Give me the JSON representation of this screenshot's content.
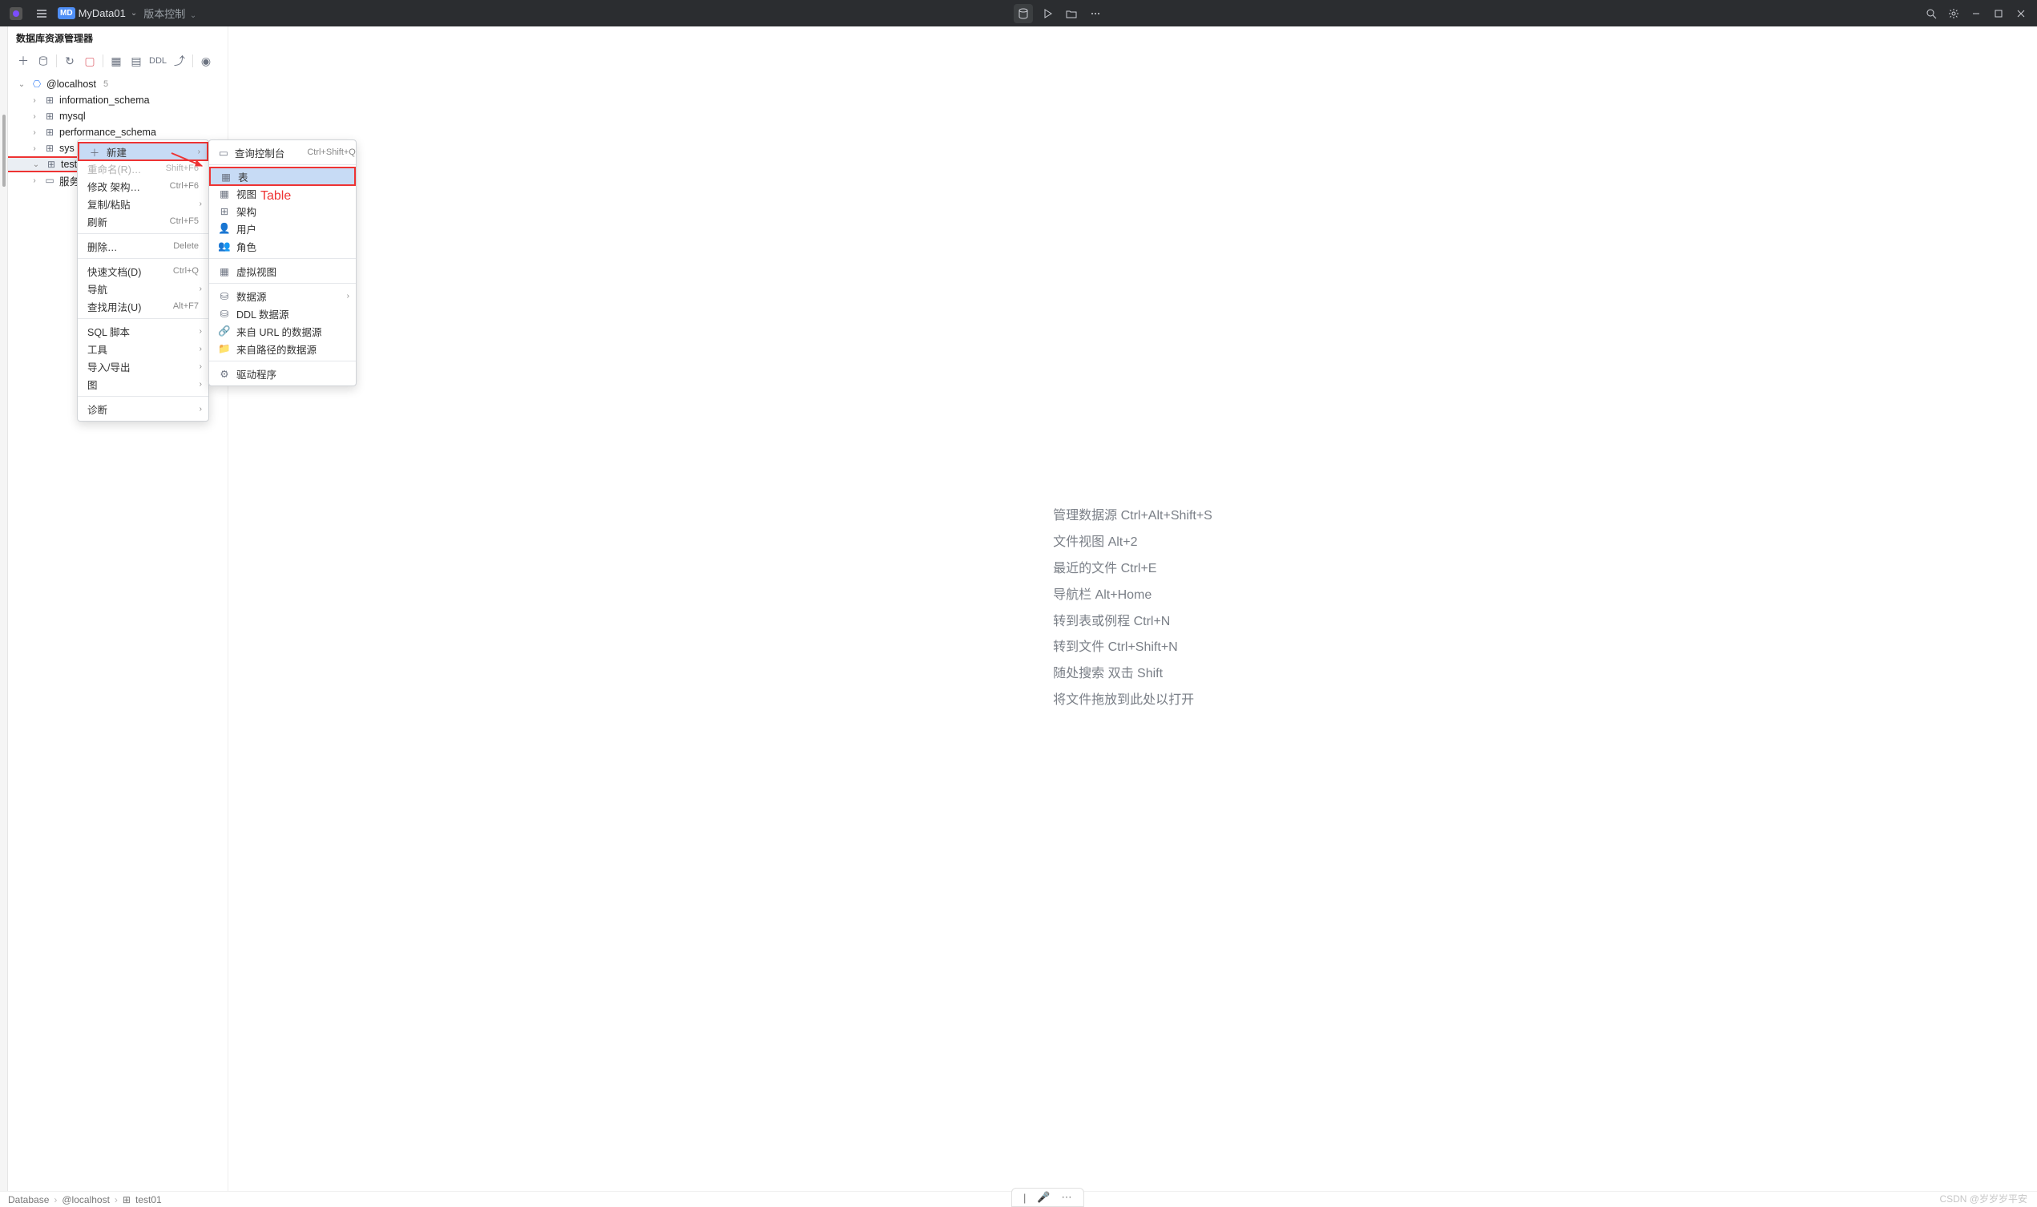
{
  "titlebar": {
    "project_badge": "MD",
    "project_name": "MyData01",
    "vcs_label": "版本控制"
  },
  "sidebar": {
    "title": "数据库资源管理器",
    "toolbar_ddl": "DDL",
    "root": {
      "label": "@localhost",
      "count": "5"
    },
    "children": [
      {
        "label": "information_schema"
      },
      {
        "label": "mysql"
      },
      {
        "label": "performance_schema"
      },
      {
        "label": "sys"
      },
      {
        "label": "test01"
      },
      {
        "label": "服务器"
      }
    ]
  },
  "context_menu": {
    "new": "新建",
    "rename": "重命名(R)…",
    "rename_kbd": "Shift+F6",
    "modify_schema": "修改 架构…",
    "modify_kbd": "Ctrl+F6",
    "copy_paste": "复制/粘贴",
    "refresh": "刷新",
    "refresh_kbd": "Ctrl+F5",
    "delete": "删除…",
    "delete_kbd": "Delete",
    "quick_doc": "快速文档(D)",
    "quick_doc_kbd": "Ctrl+Q",
    "navigate": "导航",
    "find_usages": "查找用法(U)",
    "find_usages_kbd": "Alt+F7",
    "sql_script": "SQL 脚本",
    "tools": "工具",
    "import_export": "导入/导出",
    "diagram": "图",
    "diagnose": "诊断"
  },
  "submenu": {
    "query_console": "查询控制台",
    "query_console_kbd": "Ctrl+Shift+Q",
    "table": "表",
    "view": "视图",
    "schema": "架构",
    "user": "用户",
    "role": "角色",
    "virtual_view": "虚拟视图",
    "data_source": "数据源",
    "ddl_data_source": "DDL 数据源",
    "url_data_source": "来自 URL 的数据源",
    "path_data_source": "来自路径的数据源",
    "driver": "驱动程序"
  },
  "annotation": "Table",
  "shortcuts": [
    "管理数据源 Ctrl+Alt+Shift+S",
    "文件视图 Alt+2",
    "最近的文件 Ctrl+E",
    "导航栏 Alt+Home",
    "转到表或例程 Ctrl+N",
    "转到文件 Ctrl+Shift+N",
    "随处搜索 双击 Shift",
    "将文件拖放到此处以打开"
  ],
  "breadcrumb": {
    "a": "Database",
    "b": "@localhost",
    "c": "test01"
  },
  "watermark": "CSDN @岁岁岁平安"
}
